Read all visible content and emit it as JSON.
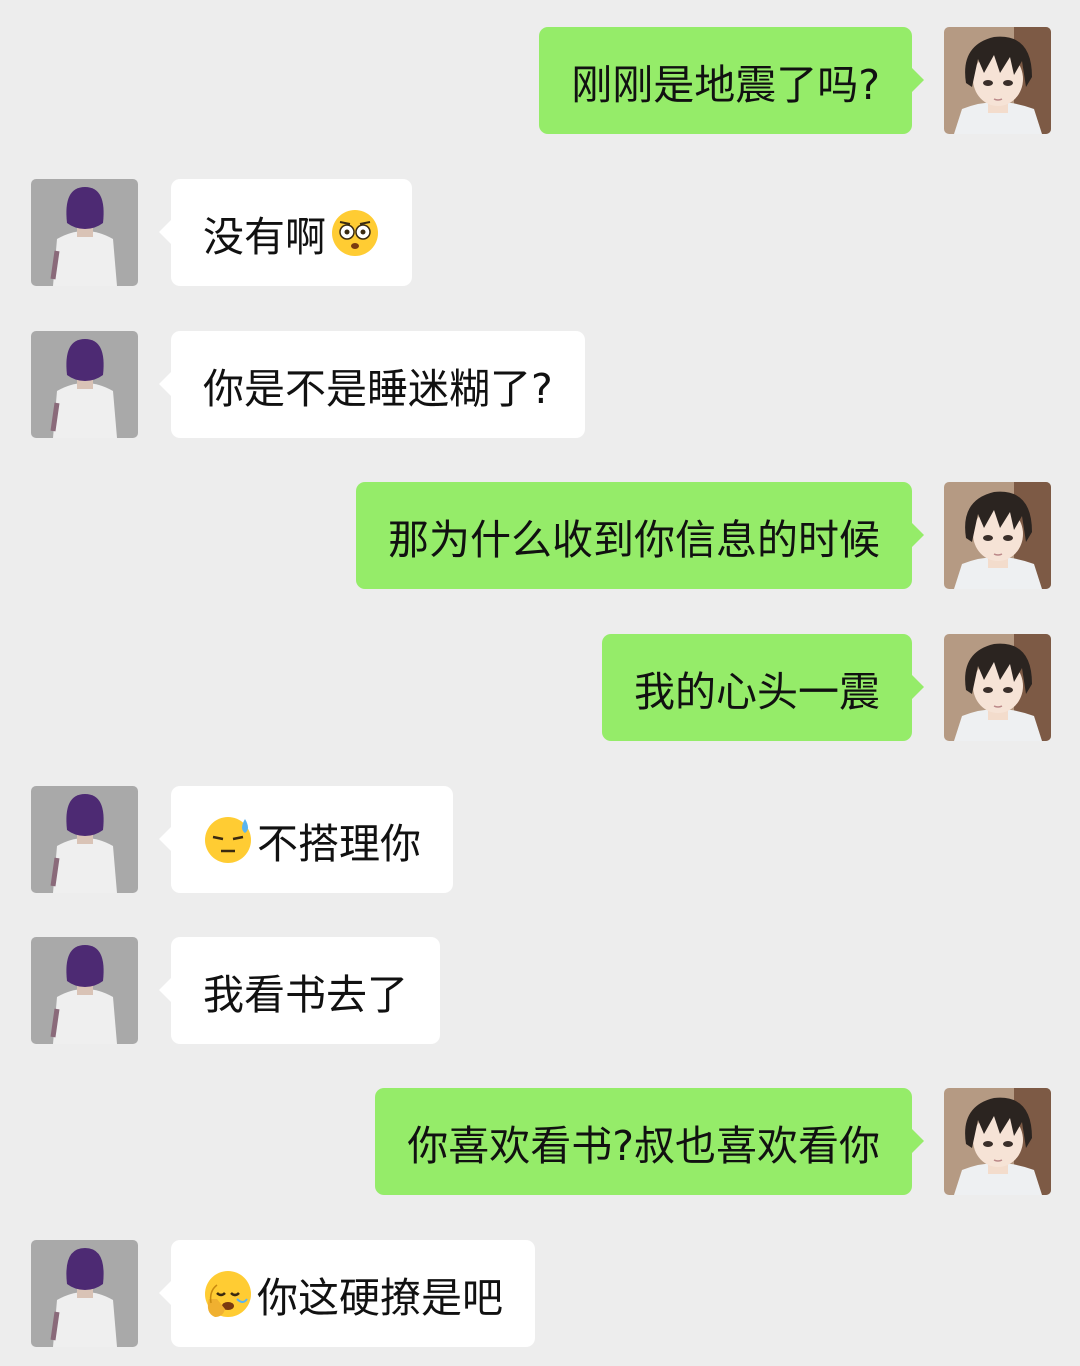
{
  "chat": {
    "messages": [
      {
        "sender": "me",
        "text": "刚刚是地震了吗?"
      },
      {
        "sender": "other",
        "text": "没有啊",
        "emoji": "flushed-face-emoji"
      },
      {
        "sender": "other",
        "text": "你是不是睡迷糊了?"
      },
      {
        "sender": "me",
        "text": "那为什么收到你信息的时候"
      },
      {
        "sender": "me",
        "text": "我的心头一震"
      },
      {
        "sender": "other",
        "text": "不搭理你",
        "emoji": "downcast-sweat-face-emoji"
      },
      {
        "sender": "other",
        "text": "我看书去了"
      },
      {
        "sender": "me",
        "text": "你喜欢看书?叔也喜欢看你"
      },
      {
        "sender": "other",
        "text": "你这硬撩是吧",
        "emoji": "facepalm-face-emoji"
      }
    ]
  },
  "colors": {
    "background": "#ededed",
    "self_bubble": "#95ec69",
    "other_bubble": "#ffffff",
    "text": "#111111"
  }
}
